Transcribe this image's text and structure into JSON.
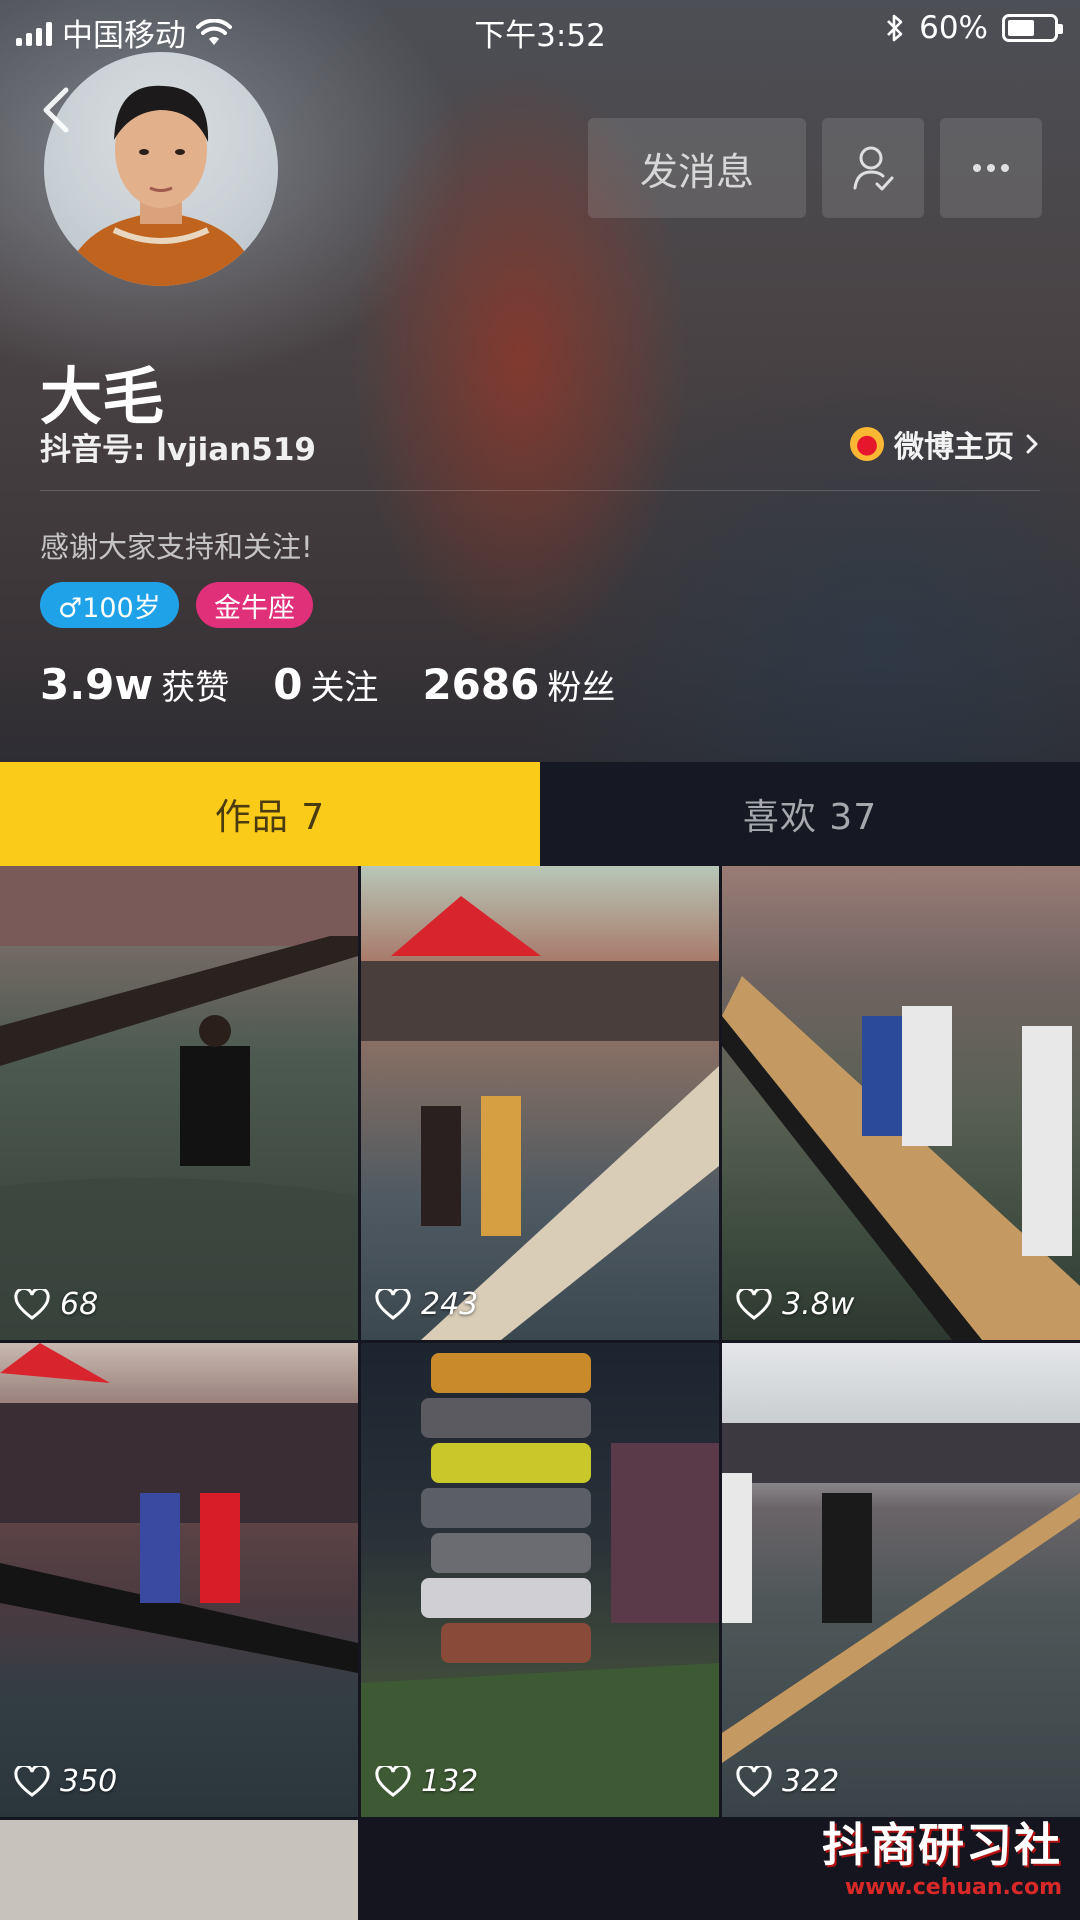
{
  "status_bar": {
    "carrier": "中国移动",
    "time": "下午3:52",
    "battery_text": "60%",
    "battery_level": 0.6
  },
  "profile": {
    "nickname": "大毛",
    "douyin_id": "抖音号: lvjian519",
    "weibo_link": "微博主页",
    "signature": "感谢大家支持和关注!",
    "tags": [
      {
        "text": "♂100岁",
        "color": "#1fa2e8"
      },
      {
        "text": "金牛座",
        "color": "#e0307a"
      }
    ],
    "stats": [
      {
        "value": "3.9w",
        "label": "获赞"
      },
      {
        "value": "0",
        "label": "关注"
      },
      {
        "value": "2686",
        "label": "粉丝"
      }
    ]
  },
  "actions": {
    "message": "发消息"
  },
  "tabs": [
    {
      "label": "作品 7",
      "active": true
    },
    {
      "label": "喜欢 37",
      "active": false
    }
  ],
  "videos": [
    {
      "likes": "68"
    },
    {
      "likes": "243"
    },
    {
      "likes": "3.8w"
    },
    {
      "likes": "350"
    },
    {
      "likes": "132"
    },
    {
      "likes": "322"
    }
  ],
  "watermark": {
    "title": "抖商研习社",
    "url": "www.cehuan.com"
  },
  "colors": {
    "tab_active": "#facc19",
    "tab_inactive": "#161823",
    "gender_tag": "#1fa2e8",
    "zodiac_tag": "#e0307a"
  }
}
